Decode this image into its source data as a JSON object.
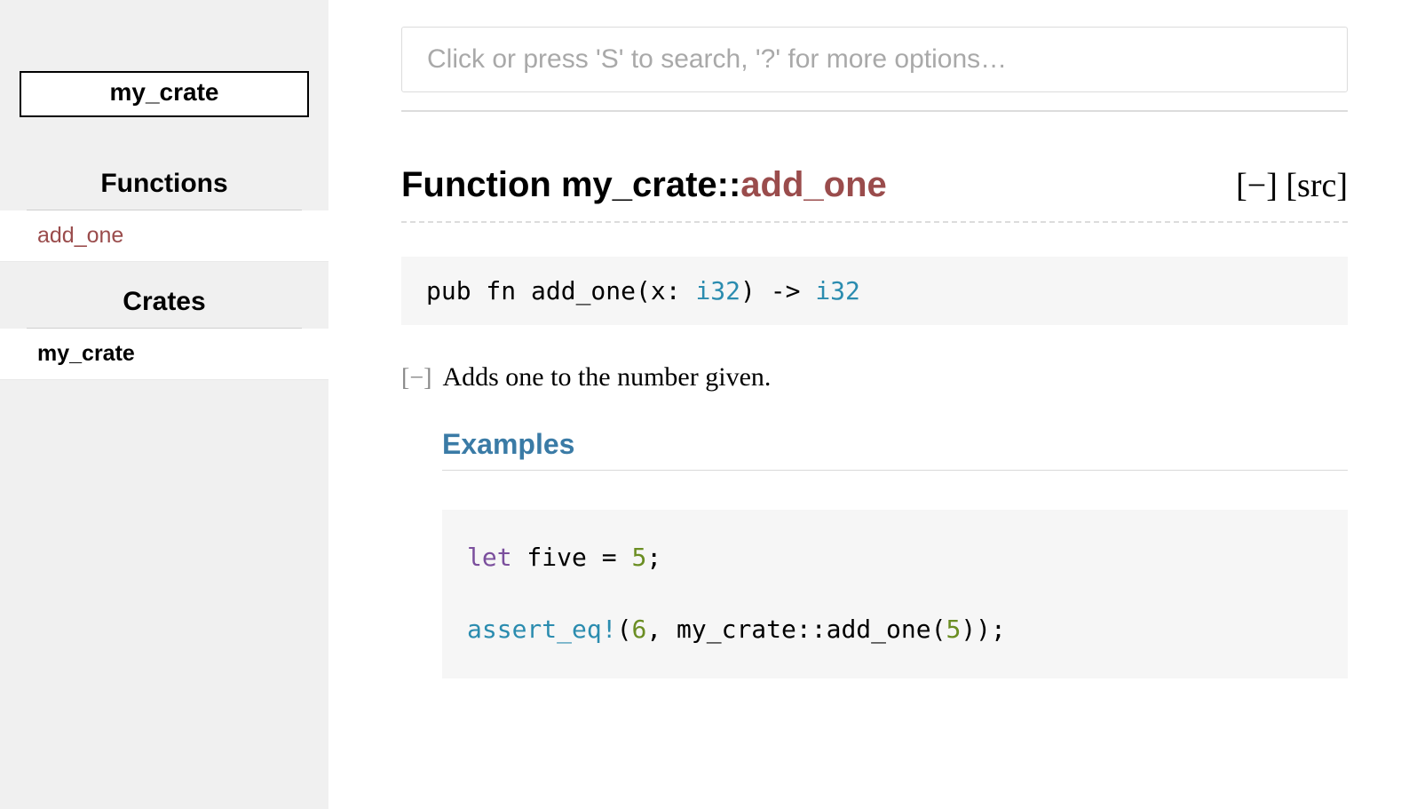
{
  "sidebar": {
    "crate_name": "my_crate",
    "sections": [
      {
        "heading": "Functions",
        "items": [
          {
            "label": "add_one",
            "kind": "fn"
          }
        ]
      },
      {
        "heading": "Crates",
        "items": [
          {
            "label": "my_crate",
            "kind": "crate"
          }
        ]
      }
    ]
  },
  "search": {
    "placeholder": "Click or press 'S' to search, '?' for more options…"
  },
  "header": {
    "kind_label": "Function ",
    "path_prefix": "my_crate",
    "sep": "::",
    "name": "add_one",
    "toggle": "[−]",
    "src": "[src]"
  },
  "signature": {
    "lead": "pub fn add_one(x: ",
    "arg_type": "i32",
    "mid": ") -> ",
    "ret_type": "i32"
  },
  "doc": {
    "mini_toggle": "[−]",
    "summary": "Adds one to the number given.",
    "examples_heading": "Examples",
    "code_tokens": [
      {
        "t": "kw",
        "v": "let"
      },
      {
        "t": "plain",
        "v": " five = "
      },
      {
        "t": "num",
        "v": "5"
      },
      {
        "t": "plain",
        "v": ";\n\n"
      },
      {
        "t": "macro",
        "v": "assert_eq!"
      },
      {
        "t": "plain",
        "v": "("
      },
      {
        "t": "num",
        "v": "6"
      },
      {
        "t": "plain",
        "v": ", my_crate::add_one("
      },
      {
        "t": "num",
        "v": "5"
      },
      {
        "t": "plain",
        "v": "));"
      }
    ]
  }
}
